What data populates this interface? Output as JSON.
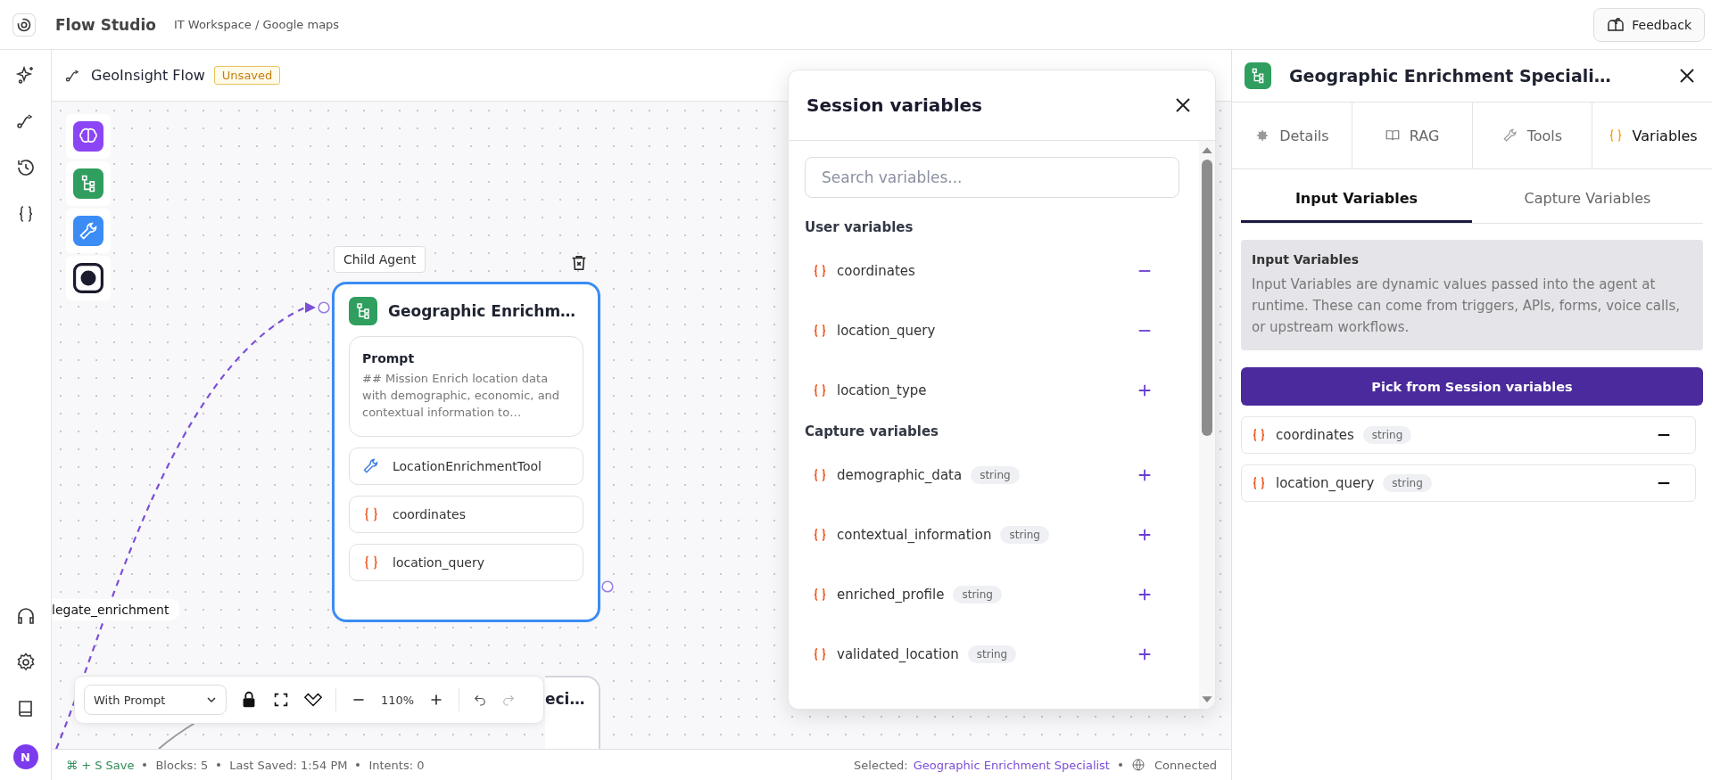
{
  "header": {
    "app_title": "Flow Studio",
    "breadcrumb": "IT Workspace / Google maps",
    "feedback_button": "Feedback"
  },
  "rail": {
    "avatar": "N"
  },
  "flow": {
    "name": "GeoInsight Flow",
    "status_badge": "Unsaved"
  },
  "canvas": {
    "edge_label": "legate_enrichment",
    "node": {
      "tag": "Child Agent",
      "title": "Geographic Enrichm…",
      "selected": true,
      "prompt_title": "Prompt",
      "prompt_text": "## Mission Enrich location data with demographic, economic, and contextual information to…",
      "items": [
        {
          "kind": "tool",
          "label": "LocationEnrichmentTool"
        },
        {
          "kind": "variable",
          "label": "coordinates"
        },
        {
          "kind": "variable",
          "label": "location_query"
        }
      ]
    },
    "node_2": {
      "title": "eci…"
    },
    "toolbar": {
      "mode": "With Prompt",
      "zoom": "110%"
    }
  },
  "status_bar": {
    "save": "⌘ + S Save",
    "blocks": "Blocks: 5",
    "last_saved": "Last Saved: 1:54 PM",
    "intents": "Intents: 0",
    "selected_label": "Selected:",
    "selected_value": "Geographic Enrichment Specialist",
    "connection": "Connected"
  },
  "session_panel": {
    "title": "Session variables",
    "search": {
      "placeholder": "Search variables..."
    },
    "sections": [
      {
        "title": "User variables",
        "variables": [
          {
            "name": "coordinates",
            "added": true
          },
          {
            "name": "location_query",
            "added": true
          },
          {
            "name": "location_type",
            "added": false
          }
        ]
      },
      {
        "title": "Capture variables",
        "variables": [
          {
            "name": "demographic_data",
            "type": "string",
            "added": false
          },
          {
            "name": "contextual_information",
            "type": "string",
            "added": false
          },
          {
            "name": "enriched_profile",
            "type": "string",
            "added": false
          },
          {
            "name": "validated_location",
            "type": "string",
            "added": false
          }
        ]
      }
    ]
  },
  "details": {
    "title": "Geographic Enrichment Speciali…",
    "tabs": [
      {
        "kind": "details",
        "label": "Details",
        "selected": false
      },
      {
        "kind": "rag",
        "label": "RAG",
        "selected": false
      },
      {
        "kind": "tools",
        "label": "Tools",
        "selected": false
      },
      {
        "kind": "variables",
        "label": "Variables",
        "selected": true
      }
    ],
    "subtabs": [
      {
        "label": "Input Variables",
        "selected": true
      },
      {
        "label": "Capture Variables",
        "selected": false
      }
    ],
    "info": {
      "title": "Input Variables",
      "text": "Input Variables are dynamic values passed into the agent at runtime. These can come from triggers, APIs, forms, voice calls, or upstream workflows."
    },
    "pick_button": "Pick from Session variables",
    "variables": [
      {
        "name": "coordinates",
        "type": "string"
      },
      {
        "name": "location_query",
        "type": "string"
      }
    ]
  }
}
